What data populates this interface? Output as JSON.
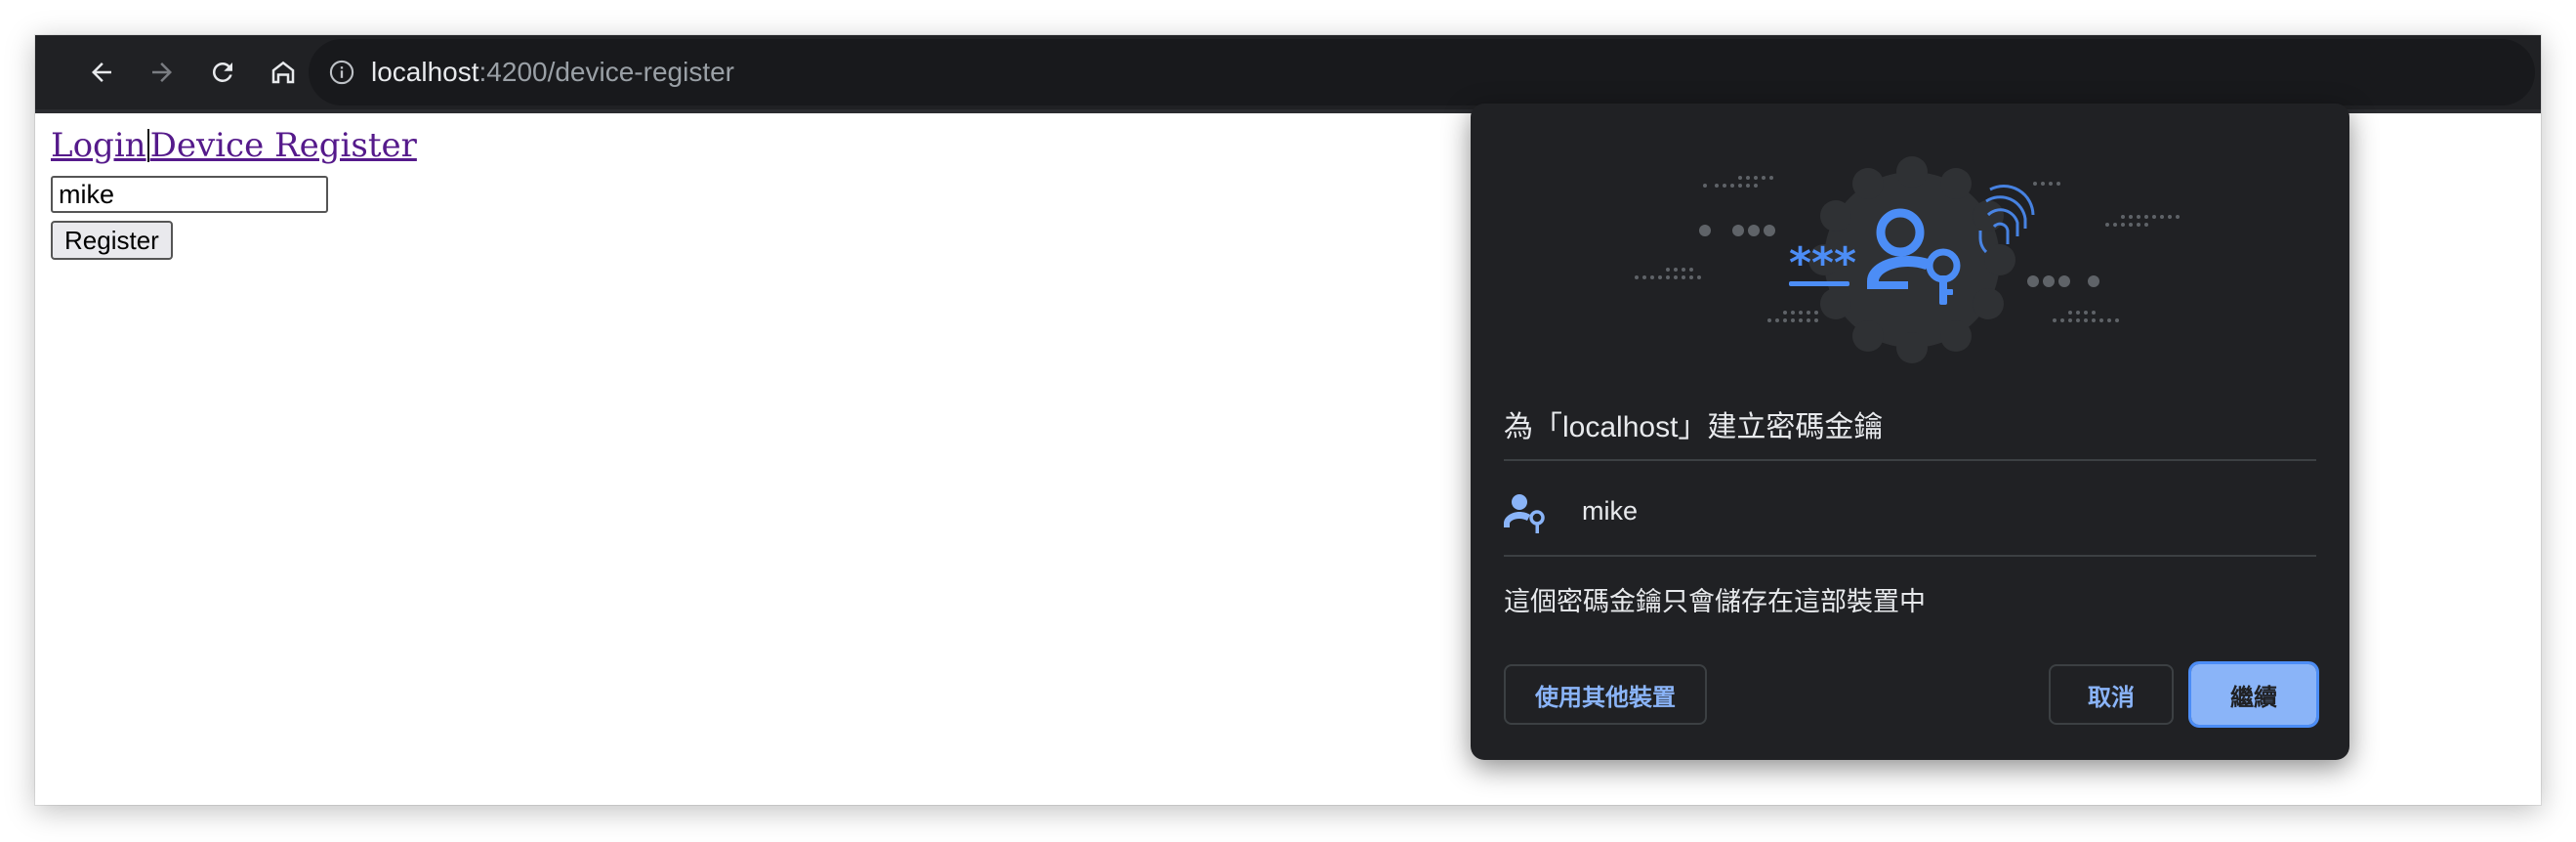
{
  "browser": {
    "url_host": "localhost",
    "url_path": ":4200/device-register",
    "icons": [
      "back-arrow-icon",
      "forward-arrow-icon",
      "reload-icon",
      "home-icon",
      "info-icon"
    ]
  },
  "page": {
    "nav_links": [
      {
        "label": "Login"
      },
      {
        "label": "Device Register"
      }
    ],
    "username_value": "mike",
    "register_button": "Register"
  },
  "dialog": {
    "title": "為「localhost」建立密碼金鑰",
    "username": "mike",
    "description": "這個密碼金鑰只會儲存在這部裝置中",
    "buttons": {
      "other_device": "使用其他裝置",
      "cancel": "取消",
      "continue": "繼續"
    },
    "hero_masked_text": "***",
    "colors": {
      "accent": "#8ab4f8",
      "brand_blue": "#4c8df6",
      "background": "#202124"
    }
  }
}
